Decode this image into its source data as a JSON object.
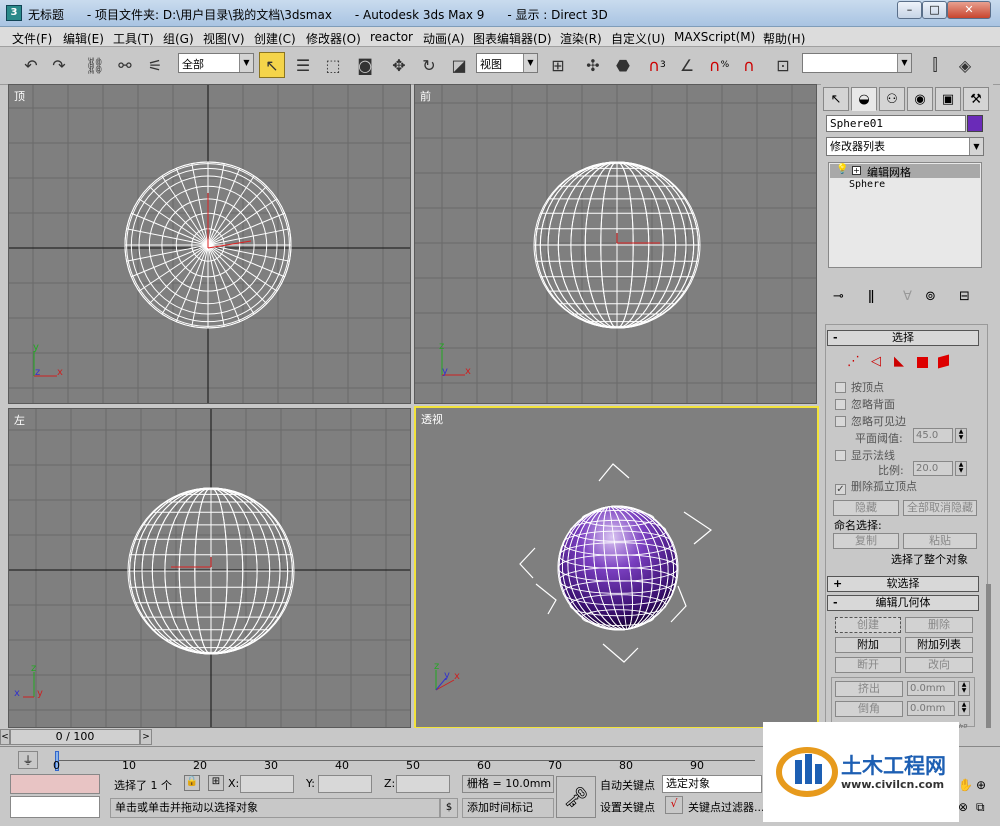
{
  "titlebar": {
    "title": "无标题      - 项目文件夹: D:\\用户目录\\我的文档\\3dsmax      - Autodesk 3ds Max 9      - 显示 : Direct 3D",
    "minimize": "–",
    "maximize": "□",
    "close": "✕"
  },
  "menu": [
    "文件(F)",
    "编辑(E)",
    "工具(T)",
    "组(G)",
    "视图(V)",
    "创建(C)",
    "修改器(O)",
    "reactor",
    "动画(A)",
    "图表编辑器(D)",
    "渲染(R)",
    "自定义(U)",
    "MAXScript(M)",
    "帮助(H)"
  ],
  "toolbar": {
    "filter_select": "全部",
    "coord_select": "视图",
    "snap_label": "3",
    "angle_snap": "3",
    "percent_snap": "%",
    "named_sel": ""
  },
  "viewports": {
    "top": "顶",
    "front": "前",
    "left": "左",
    "perspective": "透视"
  },
  "axis": {
    "x": "x",
    "y": "y",
    "z": "z"
  },
  "panel": {
    "object_name": "Sphere01",
    "color": "#6a2bb8",
    "modifier_list": "修改器列表",
    "stack": [
      "编辑网格",
      "Sphere"
    ],
    "select_rollout": "选择",
    "select_sign": "-",
    "checkboxes": {
      "by_vertex": "按顶点",
      "ignore_backface": "忽略背面",
      "ignore_visible_edges": "忽略可见边",
      "show_normals": "显示法线",
      "delete_isolated": "删除孤立顶点"
    },
    "planar_threshold_label": "平面阈值:",
    "planar_threshold_value": "45.0",
    "scale_label": "比例:",
    "scale_value": "20.0",
    "hide": "隐藏",
    "unhide_all": "全部取消隐藏",
    "named_selections": "命名选择:",
    "copy": "复制",
    "paste": "粘贴",
    "sel_status": "选择了整个对象",
    "soft_selection": "软选择",
    "soft_sign": "+",
    "edit_geometry": "编辑几何体",
    "edit_sign": "-",
    "create": "创建",
    "delete": "删除",
    "attach": "附加",
    "attach_list": "附加列表",
    "detach": "断开",
    "turn": "改向",
    "extrude": "挤出",
    "extrude_value": "0.0mm",
    "chamfer": "倒角",
    "chamfer_value": "0.0mm",
    "partial_label": "部"
  },
  "timeline": {
    "frame": "0 / 100",
    "prev": "<",
    "next": ">"
  },
  "trackbar": {
    "ticks": [
      "0",
      "10",
      "20",
      "30",
      "40",
      "50",
      "60",
      "70",
      "80",
      "90"
    ]
  },
  "status": {
    "selected": "选择了 1 个",
    "x_label": "X:",
    "y_label": "Y:",
    "z_label": "Z:",
    "grid": "栅格 = 10.0mm",
    "auto_key": "自动关键点",
    "set_key": "设置关键点",
    "selected_object": "选定对象",
    "key_filters": "关键点过滤器...",
    "prompt": "单击或单击并拖动以选择对象",
    "add_time_tag": "添加时间标记"
  },
  "watermark": {
    "brand": "土木工程网",
    "url": "www.civilcn.com"
  }
}
